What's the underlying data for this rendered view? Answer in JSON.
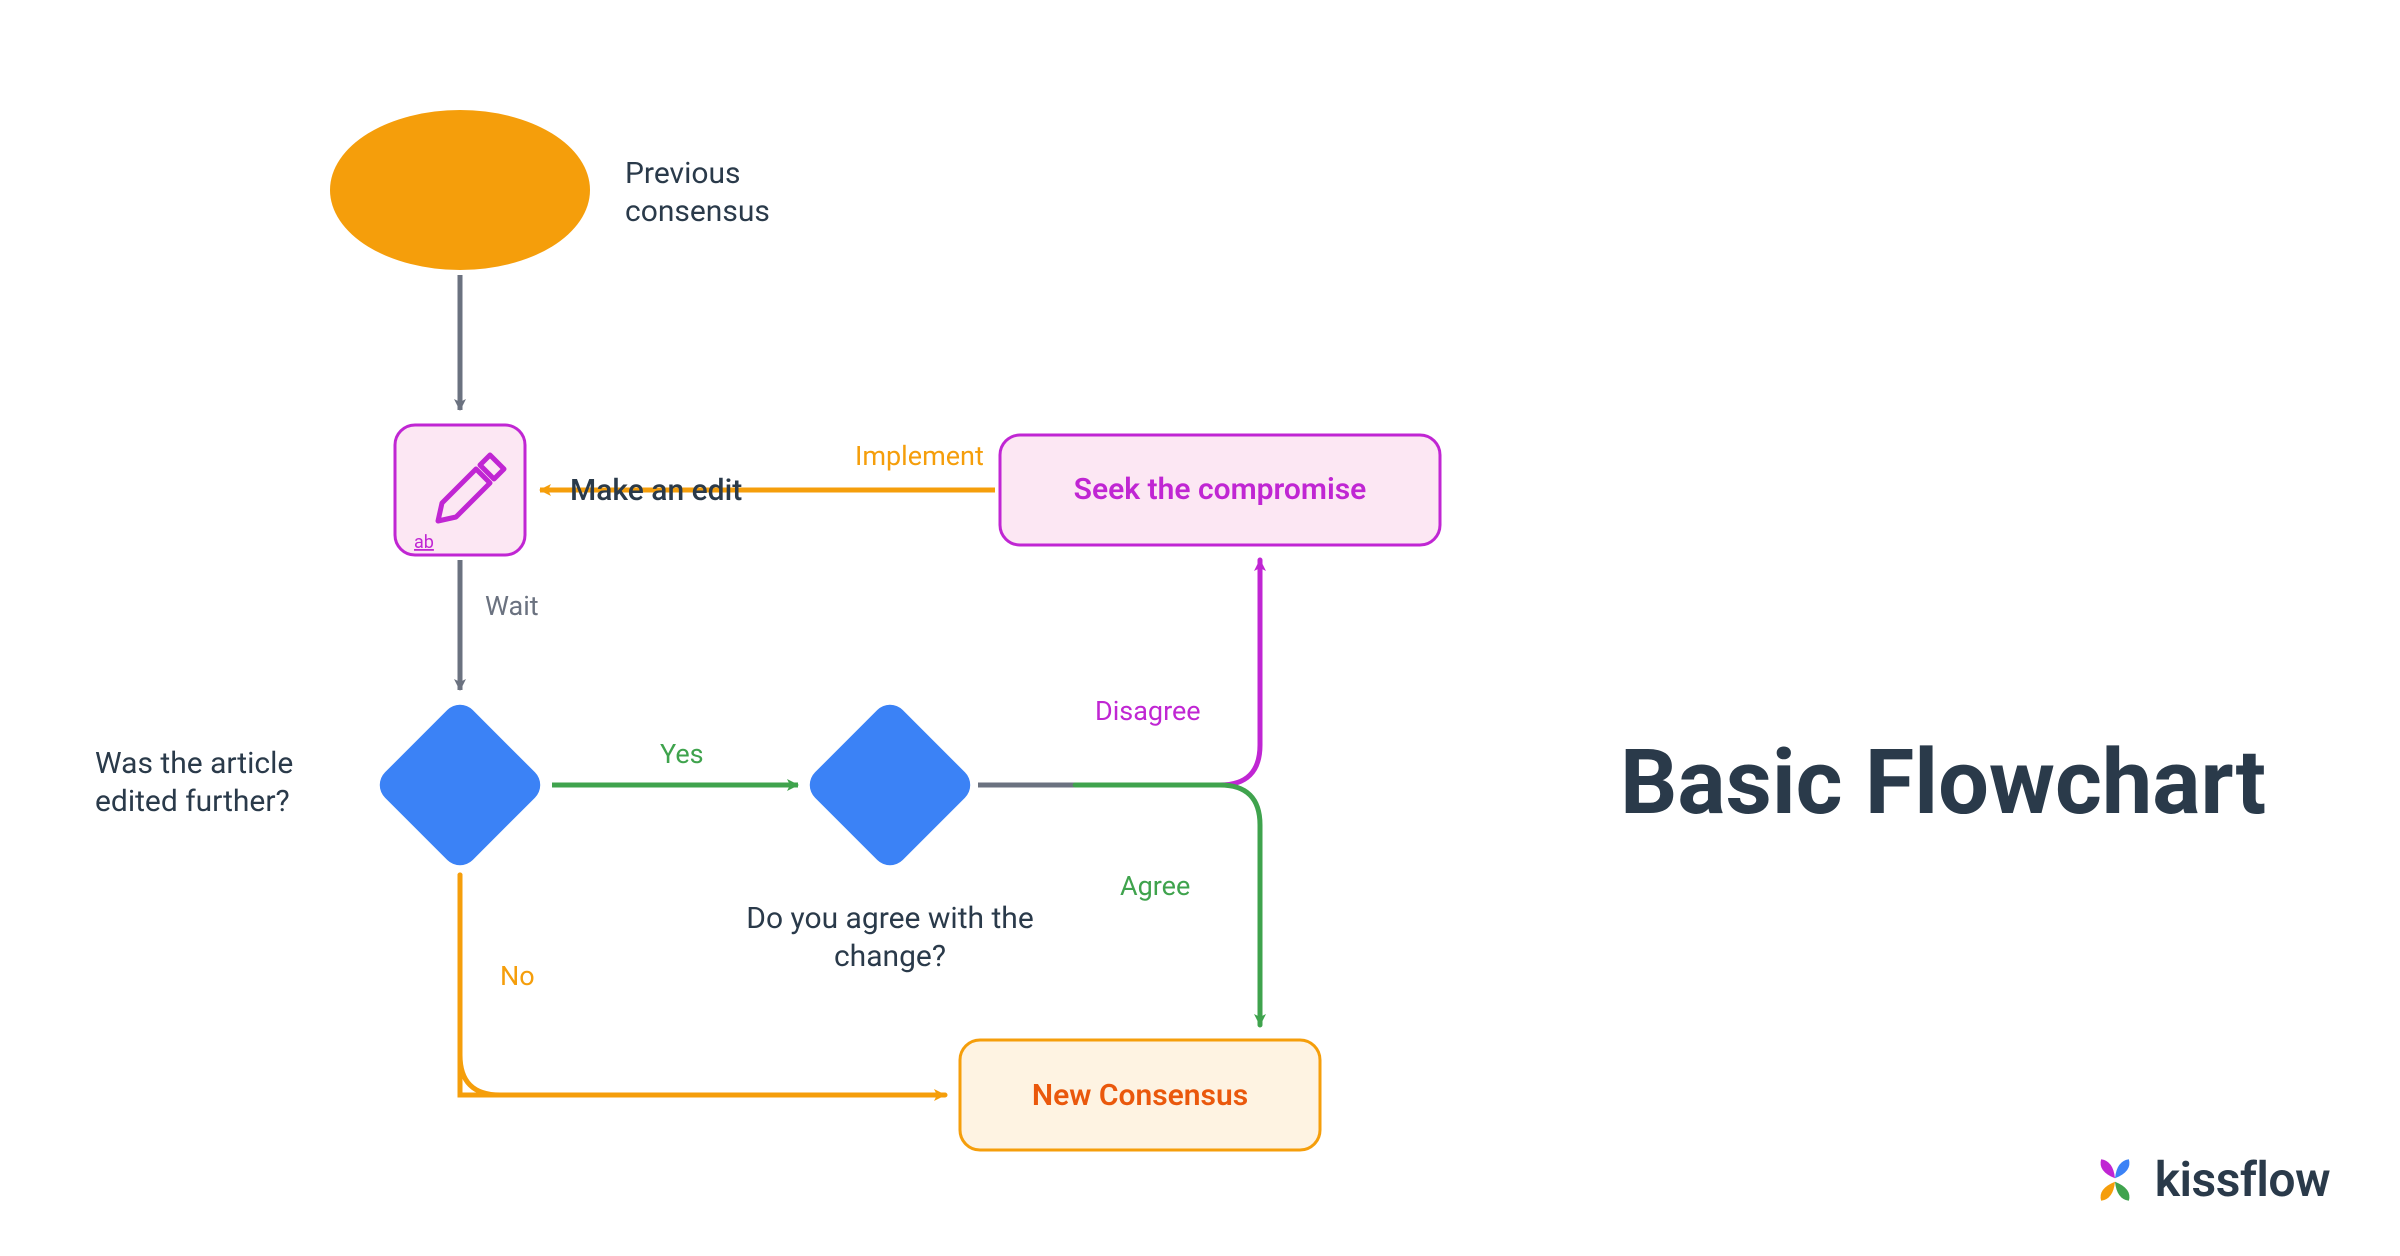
{
  "title": "Basic Flowchart",
  "brand": "kissflow",
  "nodes": {
    "start": {
      "label": "Previous consensus"
    },
    "edit": {
      "label": "Make an edit",
      "icon_caption": "ab"
    },
    "decision1": {
      "label": "Was the article edited further?"
    },
    "decision2": {
      "label": "Do you agree with the change?"
    },
    "compromise": {
      "label": "Seek the compromise"
    },
    "consensus": {
      "label": "New Consensus"
    }
  },
  "edges": {
    "wait": "Wait",
    "yes": "Yes",
    "no": "No",
    "disagree": "Disagree",
    "agree": "Agree",
    "implement": "Implement"
  }
}
